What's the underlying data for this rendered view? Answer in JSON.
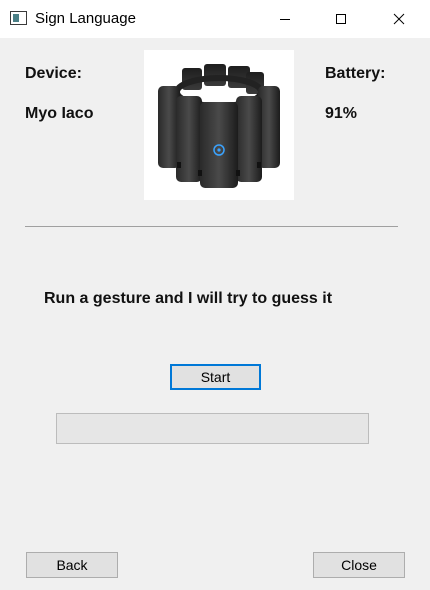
{
  "window": {
    "title": "Sign Language",
    "icon": "app-window-icon",
    "controls": [
      "minimize-icon",
      "maximize-icon",
      "close-icon"
    ]
  },
  "device": {
    "label": "Device:",
    "value": "Myo Iaco",
    "image": "myo-armband-image"
  },
  "battery": {
    "label": "Battery:",
    "value": "91%"
  },
  "instruction": "Run a gesture and I will try to guess it",
  "buttons": {
    "start": "Start",
    "back": "Back",
    "close": "Close"
  },
  "progress": {
    "value": 0
  },
  "colors": {
    "background": "#f0f0f0",
    "focus_border": "#0078d7",
    "progress_fill": "#06b025"
  }
}
